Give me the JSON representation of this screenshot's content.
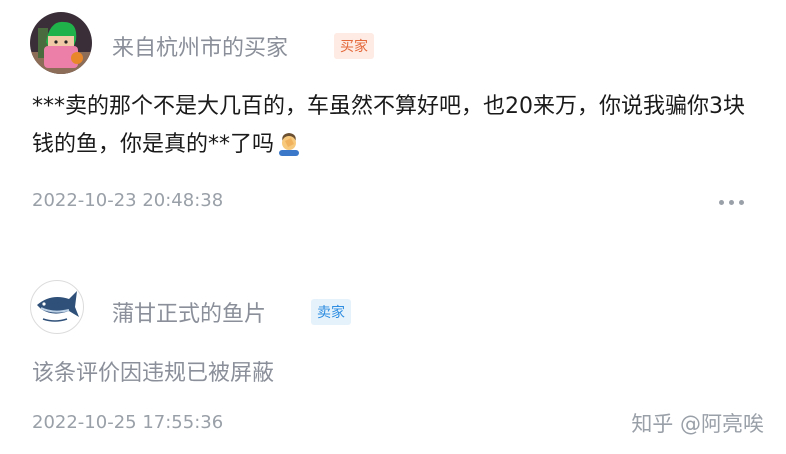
{
  "reviews": [
    {
      "username": "来自杭州市的买家",
      "role_badge": "买家",
      "text": "***卖的那个不是大几百的，车虽然不算好吧，也20来万，你说我骗你3块钱的鱼，你是真的**了吗",
      "emoji_icon": "facepalm-emoji",
      "timestamp": "2022-10-23 20:48:38",
      "more_icon": "more-horizontal-icon"
    },
    {
      "username": "蒲甘正式的鱼片",
      "role_badge": "卖家",
      "text": "该条评价因违规已被屏蔽",
      "timestamp": "2022-10-25 17:55:36"
    }
  ],
  "watermark": "知乎 @阿亮唉",
  "colors": {
    "buyer_badge_bg": "#fdebe4",
    "buyer_badge_text": "#e4693b",
    "seller_badge_bg": "#e5f2fc",
    "seller_badge_text": "#2e8de0",
    "muted_text": "#8a8f99"
  }
}
